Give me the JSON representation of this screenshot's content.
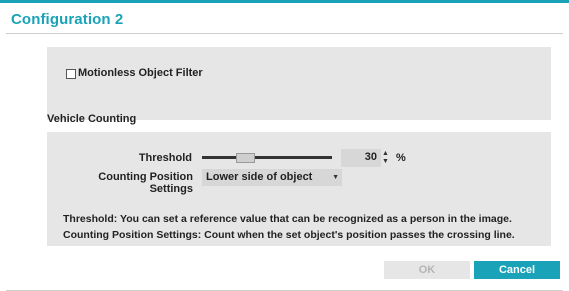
{
  "dialog": {
    "title": "Configuration 2",
    "accent_color": "#1aa3b8"
  },
  "filter": {
    "checkbox_label": "Motionless Object Filter",
    "checked": false
  },
  "vehicle_counting": {
    "section_title": "Vehicle Counting",
    "threshold": {
      "label": "Threshold",
      "value": "30",
      "unit": "%"
    },
    "counting_position": {
      "label": "Counting Position Settings",
      "selected": "Lower side of object"
    },
    "descriptions": [
      "Threshold: You can set a reference value that can be recognized as a person in the image.",
      "Counting Position Settings: Count when the set object's position passes the crossing line."
    ]
  },
  "buttons": {
    "ok": "OK",
    "cancel": "Cancel"
  }
}
